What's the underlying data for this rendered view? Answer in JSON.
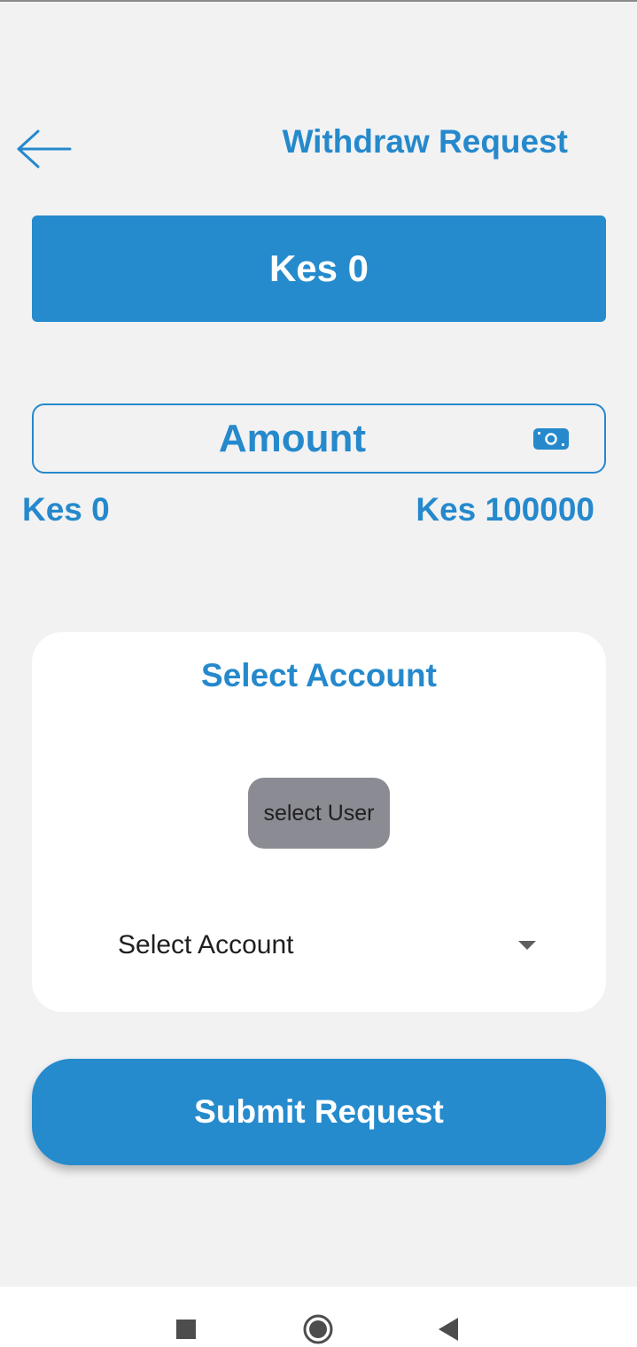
{
  "header": {
    "title": "Withdraw Request",
    "back_icon": "arrow-left-icon"
  },
  "balance": {
    "value": "Kes 0"
  },
  "amount": {
    "placeholder": "Amount",
    "icon": "money-icon"
  },
  "range": {
    "min": "Kes 0",
    "max": "Kes 100000"
  },
  "account": {
    "title": "Select Account",
    "select_user_label": "select User",
    "dropdown_value": "Select Account"
  },
  "submit": {
    "label": "Submit Request"
  },
  "colors": {
    "primary": "#258bcd",
    "background": "#f2f2f3",
    "card": "#ffffff",
    "select_user_bg": "#8a8b93"
  }
}
